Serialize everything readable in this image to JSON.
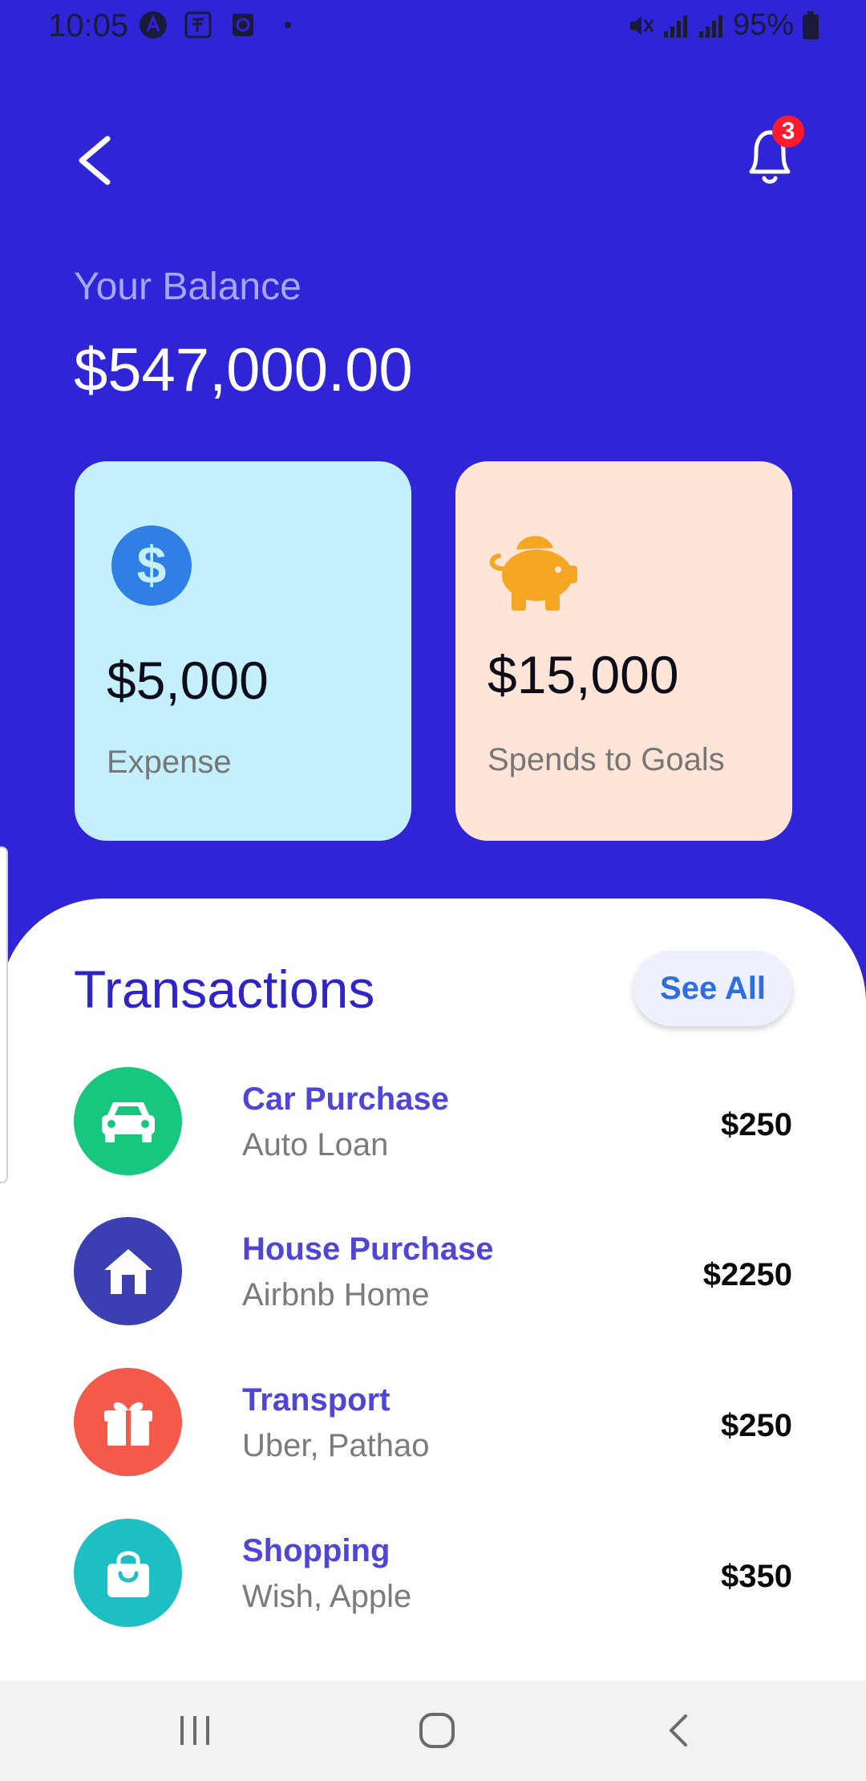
{
  "status": {
    "time": "10:05",
    "battery": "95%"
  },
  "header": {
    "notification_count": "3"
  },
  "balance": {
    "label": "Your Balance",
    "value": "$547,000.00"
  },
  "cards": [
    {
      "amount": "$5,000",
      "label": "Expense",
      "icon": "dollar-icon",
      "color": "#c4f0fd",
      "icon_color": "#2f7fe6"
    },
    {
      "amount": "$15,000",
      "label": "Spends to Goals",
      "icon": "piggy-bank-icon",
      "color": "#ffe4d8",
      "icon_color": "#f5a623"
    }
  ],
  "transactions": {
    "title": "Transactions",
    "see_all": "See All",
    "items": [
      {
        "name": "Car Purchase",
        "sub": "Auto Loan",
        "amount": "$250",
        "icon": "car-icon",
        "color": "#18c77f"
      },
      {
        "name": "House Purchase",
        "sub": "Airbnb Home",
        "amount": "$2250",
        "icon": "home-icon",
        "color": "#3b3fb1"
      },
      {
        "name": "Transport",
        "sub": "Uber, Pathao",
        "amount": "$250",
        "icon": "gift-icon",
        "color": "#f35a4b"
      },
      {
        "name": "Shopping",
        "sub": "Wish, Apple",
        "amount": "$350",
        "icon": "shopping-bag-icon",
        "color": "#1dbfc4"
      }
    ]
  }
}
